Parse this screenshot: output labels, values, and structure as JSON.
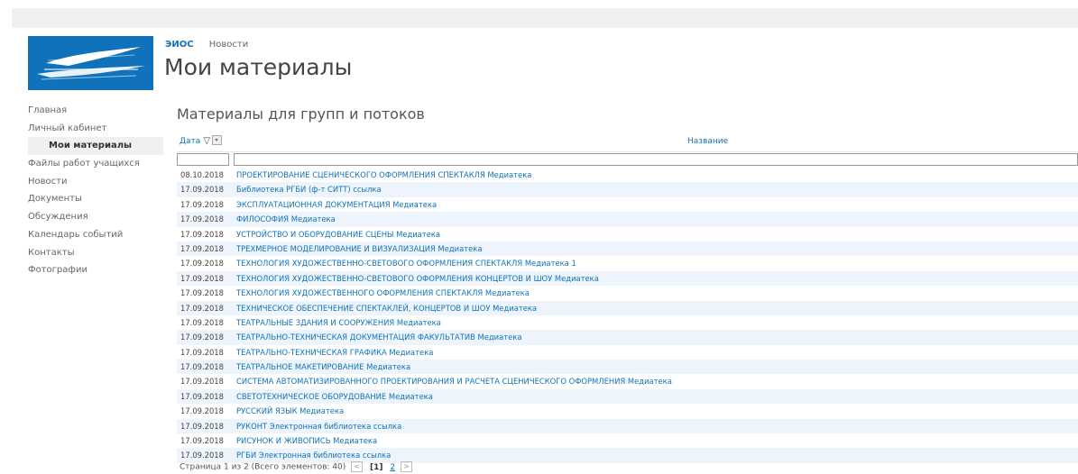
{
  "header": {
    "site_link": "ЭИОС",
    "page_link": "Новости",
    "page_title": "Мои материалы"
  },
  "logo": {
    "name": "bird-logo-icon",
    "color": "#0f72ba"
  },
  "leftnav": {
    "items": [
      {
        "label": "Главная"
      },
      {
        "label": "Личный кабинет"
      },
      {
        "label": "Мои материалы",
        "selected": true
      },
      {
        "label": "Файлы работ учащихся"
      },
      {
        "label": "Новости"
      },
      {
        "label": "Документы"
      },
      {
        "label": "Обсуждения"
      },
      {
        "label": "Календарь событий"
      },
      {
        "label": "Контакты"
      },
      {
        "label": "Фотографии"
      }
    ]
  },
  "main": {
    "section_title": "Материалы для групп и потоков",
    "columns": {
      "date": "Дата",
      "name": "Название"
    },
    "rows": [
      {
        "date": "08.10.2018",
        "name": "ПРОЕКТИРОВАНИЕ СЦЕНИЧЕСКОГО ОФОРМЛЕНИЯ СПЕКТАКЛЯ Медиатека"
      },
      {
        "date": "17.09.2018",
        "name": "Библиотека РГБИ (ф-т СИТТ) ссылка"
      },
      {
        "date": "17.09.2018",
        "name": "ЭКСПЛУАТАЦИОННАЯ ДОКУМЕНТАЦИЯ Медиатека"
      },
      {
        "date": "17.09.2018",
        "name": "ФИЛОСОФИЯ Медиатека"
      },
      {
        "date": "17.09.2018",
        "name": "УСТРОЙСТВО И ОБОРУДОВАНИЕ СЦЕНЫ Медиатека"
      },
      {
        "date": "17.09.2018",
        "name": "ТРЕХМЕРНОЕ МОДЕЛИРОВАНИЕ И ВИЗУАЛИЗАЦИЯ Медиатека"
      },
      {
        "date": "17.09.2018",
        "name": "ТЕХНОЛОГИЯ ХУДОЖЕСТВЕННО-СВЕТОВОГО ОФОРМЛЕНИЯ СПЕКТАКЛЯ Медиатека 1"
      },
      {
        "date": "17.09.2018",
        "name": "ТЕХНОЛОГИЯ ХУДОЖЕСТВЕННО-СВЕТОВОГО ОФОРМЛЕНИЯ КОНЦЕРТОВ И ШОУ Медиатека"
      },
      {
        "date": "17.09.2018",
        "name": "ТЕХНОЛОГИЯ ХУДОЖЕСТВЕННОГО ОФОРМЛЕНИЯ СПЕКТАКЛЯ Медиатека"
      },
      {
        "date": "17.09.2018",
        "name": "ТЕХНИЧЕСКОЕ ОБЕСПЕЧЕНИЕ СПЕКТАКЛЕЙ, КОНЦЕРТОВ И ШОУ Медиатека"
      },
      {
        "date": "17.09.2018",
        "name": "ТЕАТРАЛЬНЫЕ ЗДАНИЯ И СООРУЖЕНИЯ Медиатека"
      },
      {
        "date": "17.09.2018",
        "name": "ТЕАТРАЛЬНО-ТЕХНИЧЕСКАЯ ДОКУМЕНТАЦИЯ ФАКУЛЬТАТИВ Медиатека"
      },
      {
        "date": "17.09.2018",
        "name": "ТЕАТРАЛЬНО-ТЕХНИЧЕСКАЯ ГРАФИКА Медиатека"
      },
      {
        "date": "17.09.2018",
        "name": "ТЕАТРАЛЬНОЕ МАКЕТИРОВАНИЕ Медиатека"
      },
      {
        "date": "17.09.2018",
        "name": "СИСТЕМА АВТОМАТИЗИРОВАННОГО ПРОЕКТИРОВАНИЯ И РАСЧЕТА СЦЕНИЧЕСКОГО ОФОРМЛЕНИЯ Медиатека"
      },
      {
        "date": "17.09.2018",
        "name": "СВЕТОТЕХНИЧЕСКОЕ ОБОРУДОВАНИЕ Медиатека"
      },
      {
        "date": "17.09.2018",
        "name": "РУССКИЙ ЯЗЫК Медиатека"
      },
      {
        "date": "17.09.2018",
        "name": "РУКОНТ Электронная библиотека ссылка"
      },
      {
        "date": "17.09.2018",
        "name": "РИСУНОК И ЖИВОПИСЬ Медиатека"
      },
      {
        "date": "17.09.2018",
        "name": "РГБИ Электронная библиотека ссылка"
      }
    ]
  },
  "pager": {
    "summary": "Страница 1 из 2 (Всего элементов: 40)",
    "current": "[1]",
    "next_page": "2"
  },
  "colors": {
    "accent": "#0f72ba",
    "row_alt": "#eef4fb"
  }
}
